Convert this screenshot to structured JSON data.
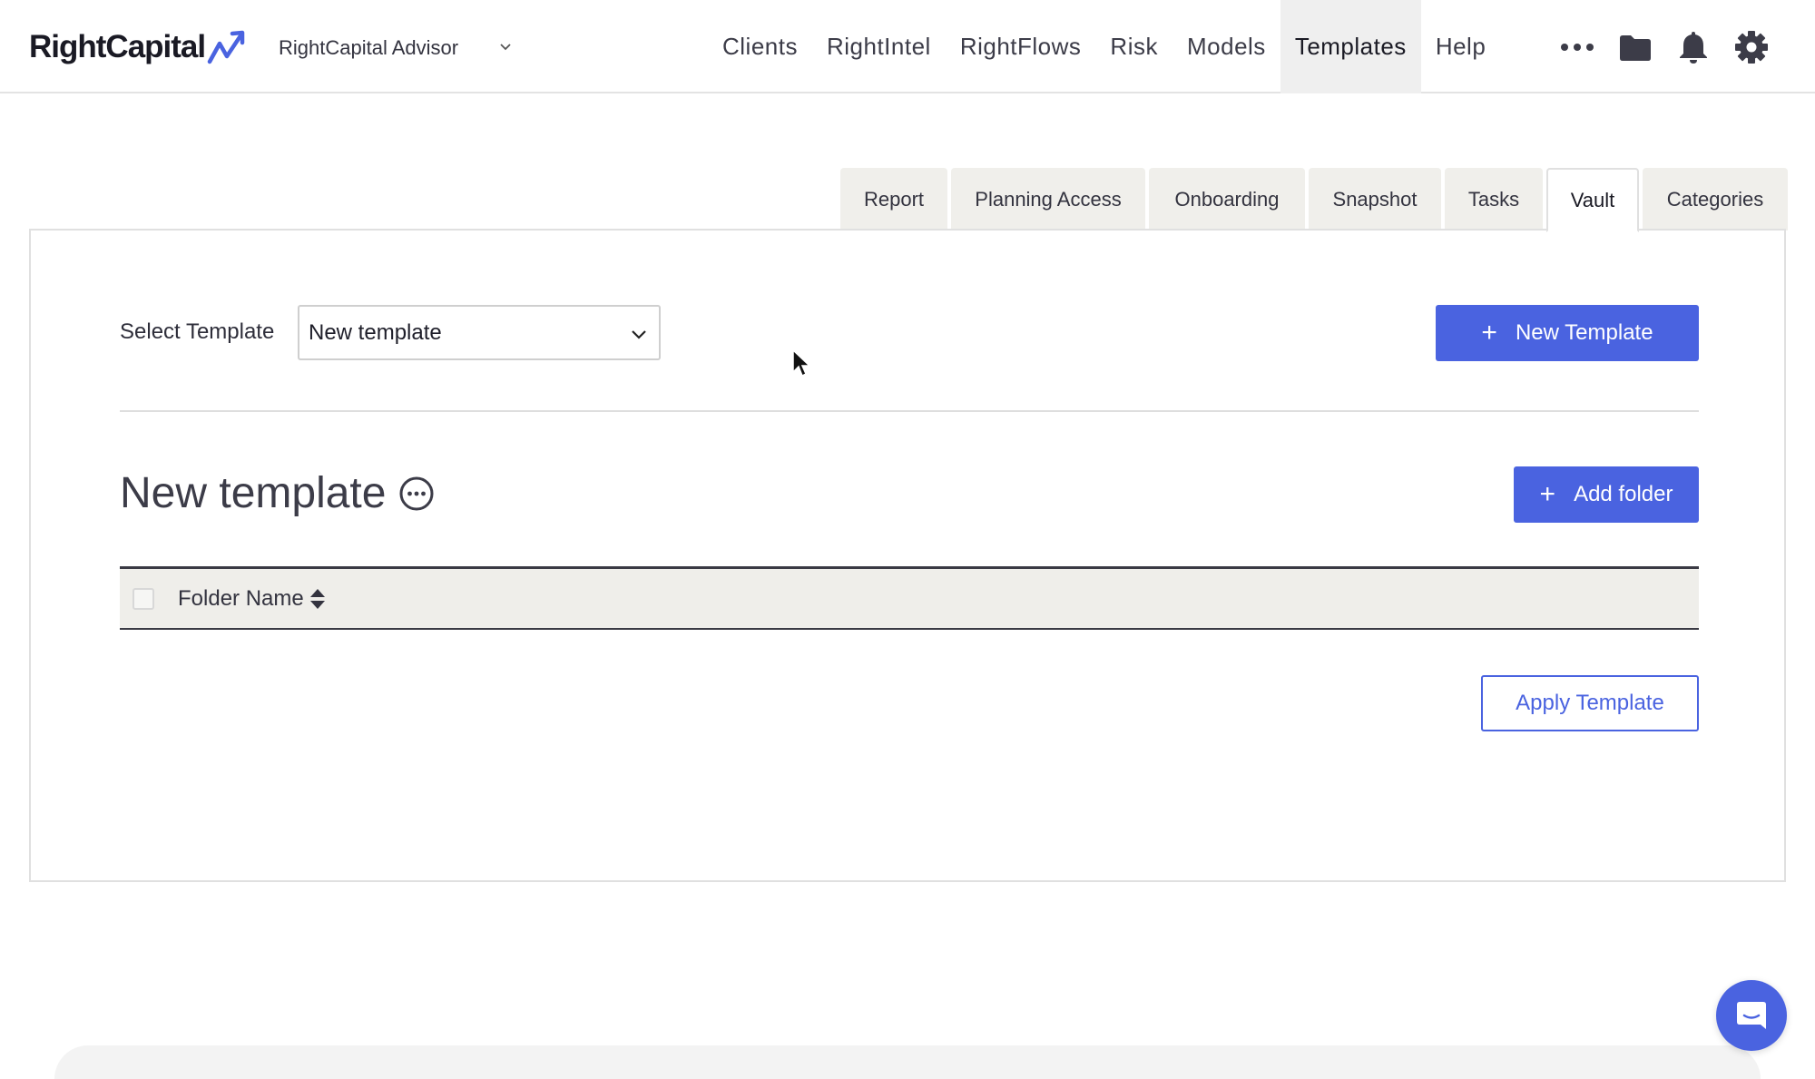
{
  "brand": {
    "name": "RightCapital",
    "accent": "#4a63e0"
  },
  "advisor": {
    "label": "RightCapital Advisor"
  },
  "nav": {
    "items": [
      "Clients",
      "RightIntel",
      "RightFlows",
      "Risk",
      "Models",
      "Templates",
      "Help"
    ],
    "active": "Templates",
    "icons": [
      "more-icon",
      "folder-icon",
      "bell-icon",
      "gear-icon"
    ]
  },
  "tabs": {
    "items": [
      "Report",
      "Planning Access",
      "Onboarding",
      "Snapshot",
      "Tasks",
      "Vault",
      "Categories"
    ],
    "active": "Vault"
  },
  "main": {
    "select_label": "Select Template",
    "select_value": "New template",
    "new_template_button": "New Template",
    "template_title": "New template",
    "add_folder_button": "Add folder",
    "table": {
      "columns": [
        "Folder Name"
      ]
    },
    "apply_button": "Apply Template"
  }
}
